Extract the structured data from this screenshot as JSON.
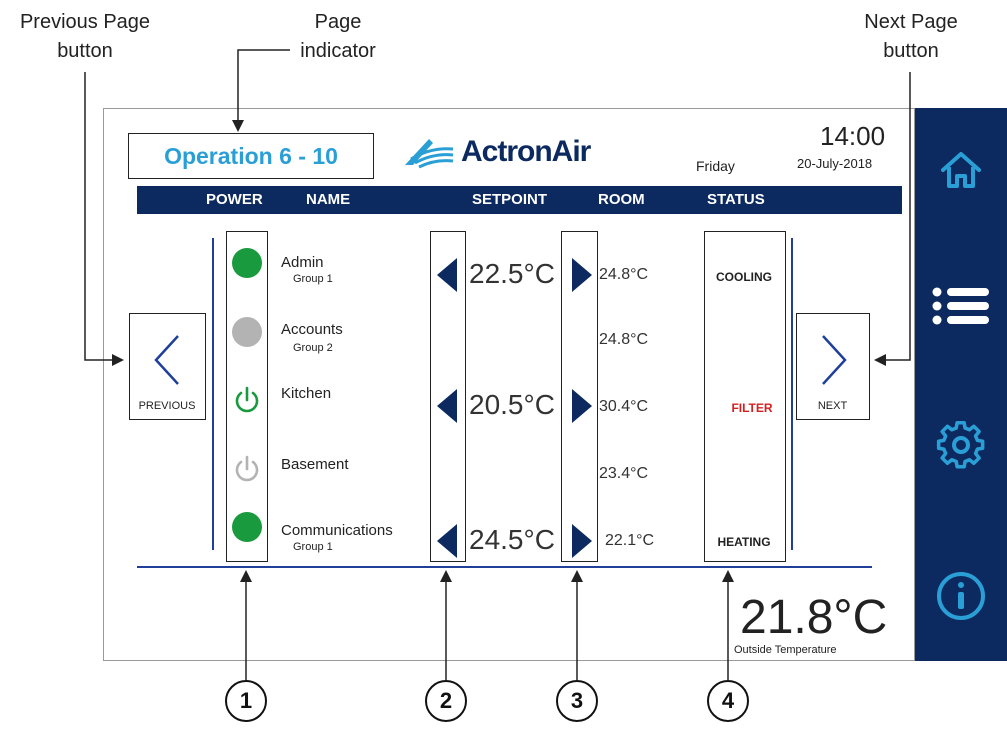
{
  "callouts": {
    "previous": "Previous Page\nbutton",
    "page_indicator": "Page\nindicator",
    "next": "Next Page\nbutton",
    "numbers": [
      "1",
      "2",
      "3",
      "4"
    ]
  },
  "header": {
    "page_indicator": "Operation 6 - 10",
    "brand": "ActronAir",
    "day": "Friday",
    "time": "14:00",
    "date": "20-July-2018"
  },
  "columns": {
    "power": "POWER",
    "name": "NAME",
    "setpoint": "SETPOINT",
    "room": "ROOM",
    "status": "STATUS"
  },
  "zones": [
    {
      "name": "Admin",
      "group": "Group 1",
      "power_icon": "power-dot-on-icon",
      "setpoint": "22.5°C",
      "room": "24.8°C",
      "status": "COOLING"
    },
    {
      "name": "Accounts",
      "group": "Group 2",
      "power_icon": "power-dot-off-icon",
      "setpoint": "",
      "room": "24.8°C",
      "status": ""
    },
    {
      "name": "Kitchen",
      "group": "",
      "power_icon": "power-symbol-on-icon",
      "setpoint": "20.5°C",
      "room": "30.4°C",
      "status": "FILTER"
    },
    {
      "name": "Basement",
      "group": "",
      "power_icon": "power-symbol-off-icon",
      "setpoint": "",
      "room": "23.4°C",
      "status": ""
    },
    {
      "name": "Communications",
      "group": "Group 1",
      "power_icon": "power-dot-on-icon",
      "setpoint": "24.5°C",
      "room": "22.1°C",
      "status": "HEATING"
    }
  ],
  "nav": {
    "previous_label": "PREVIOUS",
    "next_label": "NEXT"
  },
  "outside": {
    "temperature": "21.8°C",
    "label": "Outside Temperature"
  },
  "sidebar": {
    "items": [
      "home-icon",
      "menu-icon",
      "settings-icon",
      "info-icon"
    ]
  },
  "colors": {
    "navy": "#0c2a60",
    "accent_blue": "#2a9fd6",
    "line_blue": "#1f3f9a",
    "power_on": "#1a9a3e",
    "power_off": "#b3b3b3",
    "filter_red": "#d42020"
  }
}
